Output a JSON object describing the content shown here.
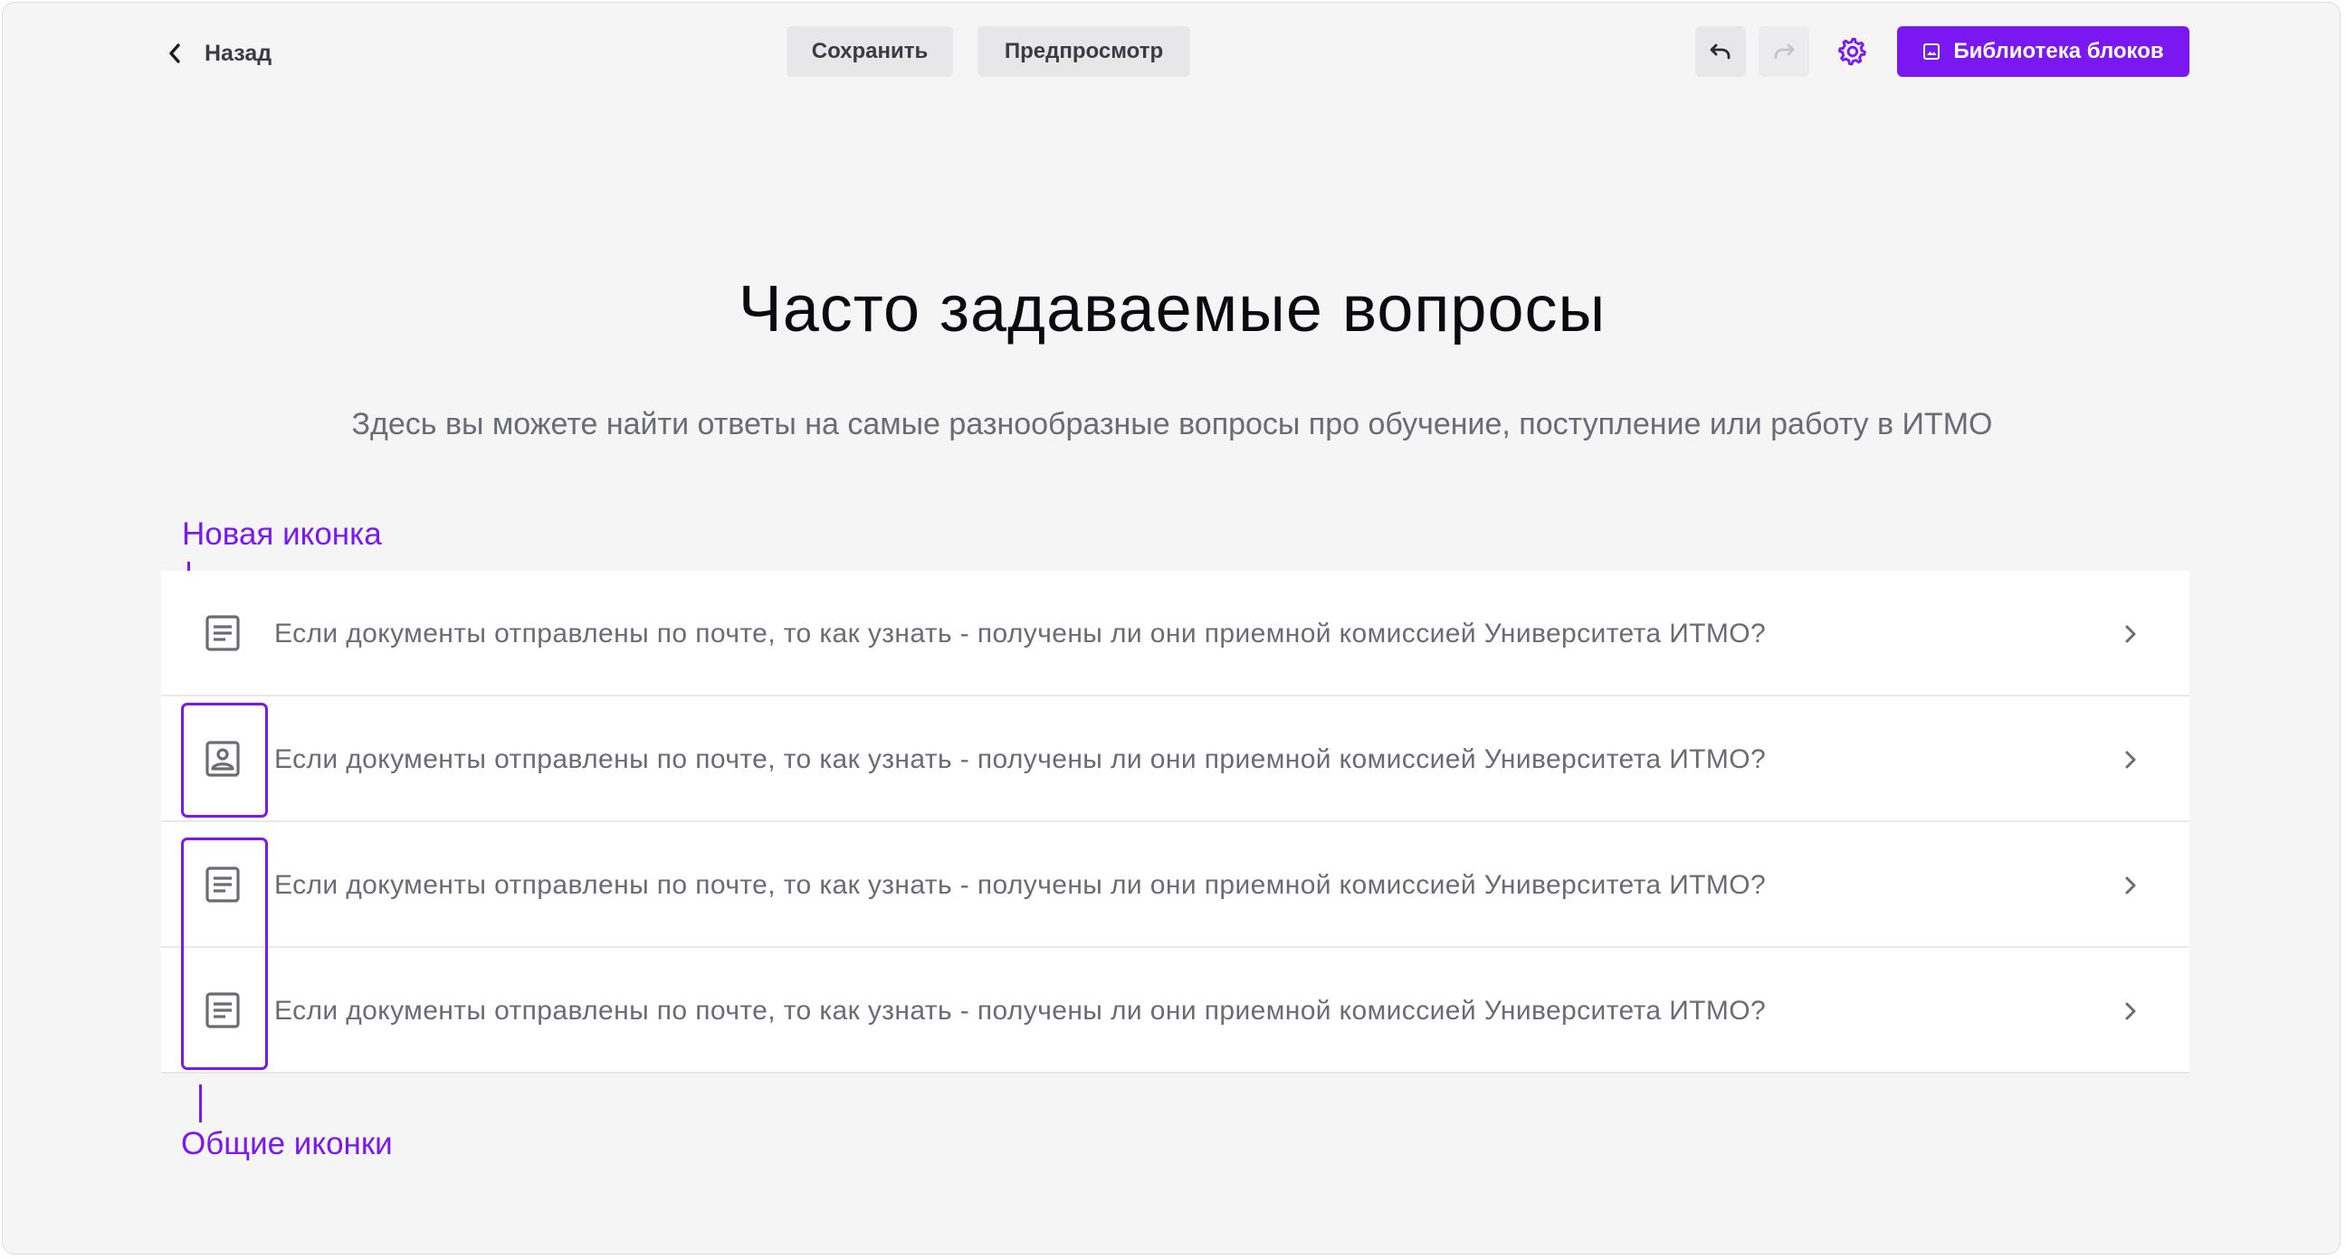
{
  "toolbar": {
    "back_label": "Назад",
    "save_label": "Сохранить",
    "preview_label": "Предпросмотр",
    "library_label": "Библиотека блоков",
    "accent_color": "#7B17F1"
  },
  "icons": {
    "back": "chevron-left-icon",
    "undo": "undo-icon",
    "redo": "redo-icon",
    "settings": "gear-icon",
    "library": "image-icon",
    "row_arrow": "chevron-right-icon"
  },
  "header": {
    "title": "Часто задаваемые вопросы",
    "subtitle": "Здесь вы можете найти ответы на самые разнообразные вопросы про обучение, поступление или работу в ИТМО"
  },
  "annotations": {
    "new_icon": "Новая иконка",
    "common_icons": "Общие иконки"
  },
  "faq": {
    "items": [
      {
        "icon": "document-icon",
        "question": "Если документы отправлены по почте, то как узнать - получены ли они приемной комиссией Университета ИТМО?"
      },
      {
        "icon": "person-card-icon",
        "question": "Если документы отправлены по почте, то как узнать - получены ли они приемной комиссией Университета ИТМО?"
      },
      {
        "icon": "document-icon",
        "question": "Если документы отправлены по почте, то как узнать - получены ли они приемной комиссией Университета ИТМО?"
      },
      {
        "icon": "document-icon",
        "question": "Если документы отправлены по почте, то как узнать - получены ли они приемной комиссией Университета ИТМО?"
      }
    ]
  }
}
